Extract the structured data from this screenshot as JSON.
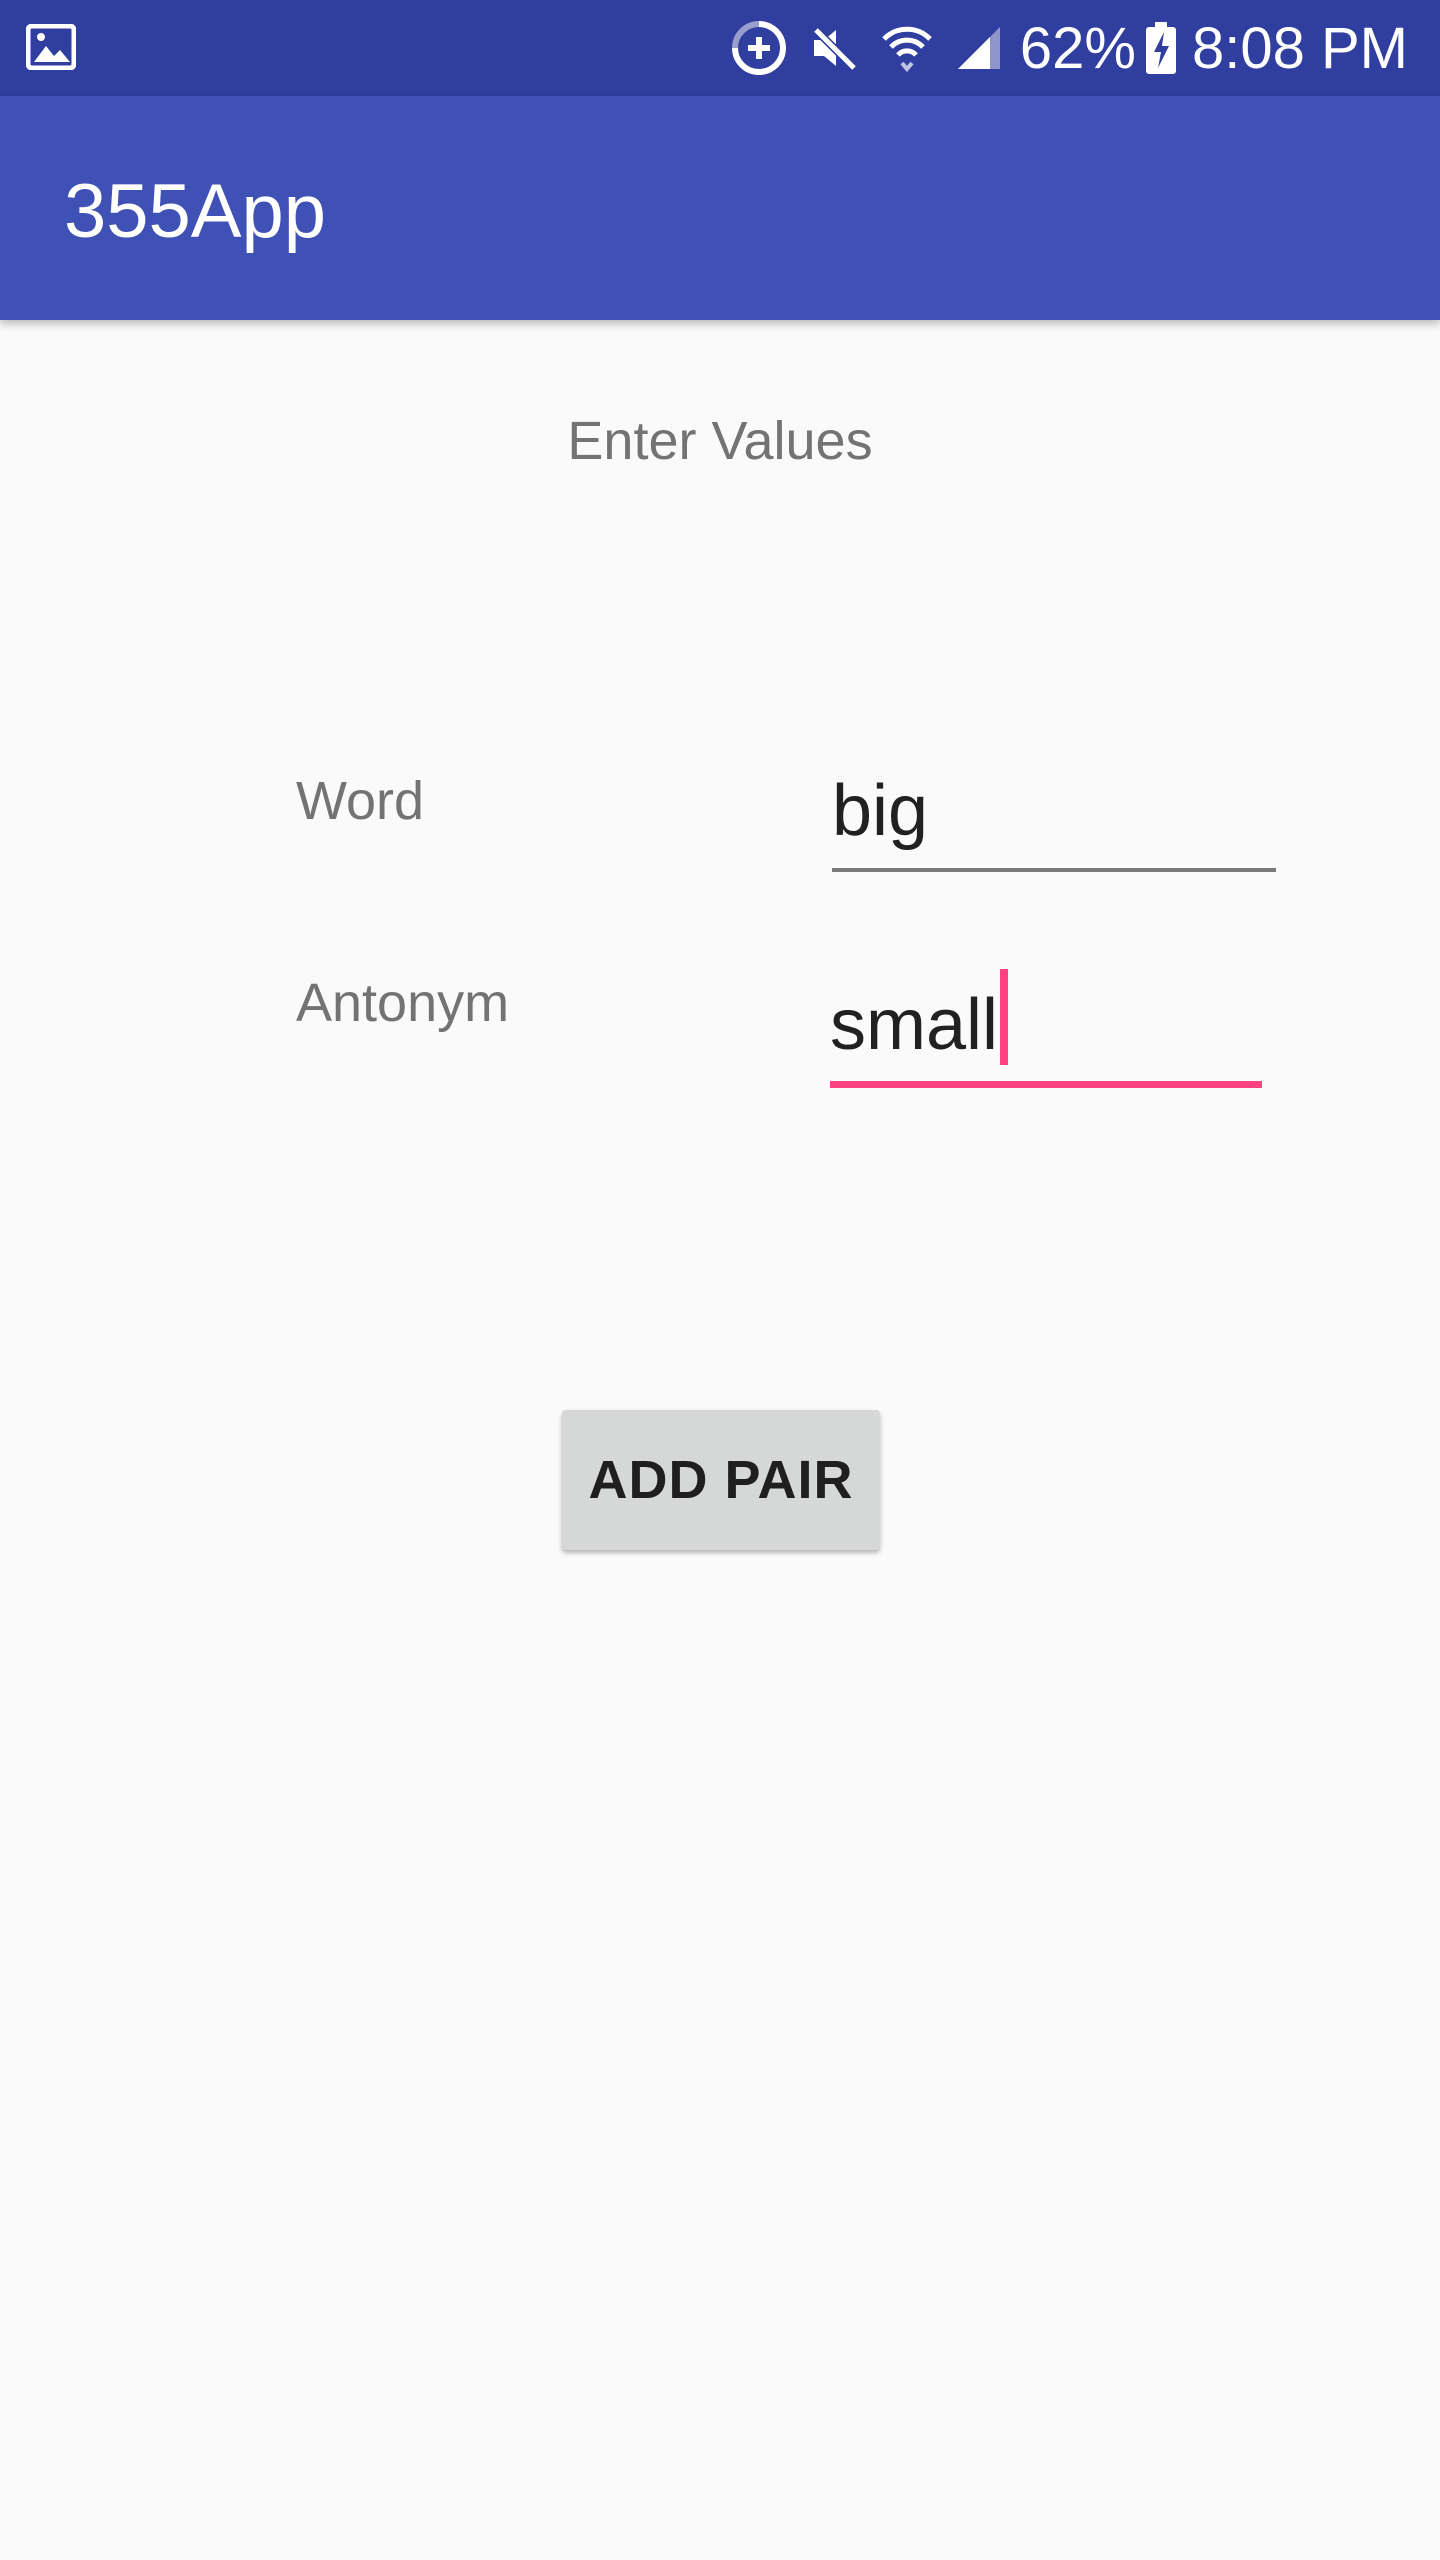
{
  "status_bar": {
    "battery": "62%",
    "time": "8:08 PM",
    "icons": [
      "gallery-icon",
      "data-saver-icon",
      "mute-icon",
      "wifi-icon",
      "signal-icon",
      "battery-charging-icon"
    ]
  },
  "app_bar": {
    "title": "355App"
  },
  "form": {
    "heading": "Enter Values",
    "word_label": "Word",
    "word_value": "big",
    "antonym_label": "Antonym",
    "antonym_value": "small",
    "add_button_label": "ADD PAIR"
  },
  "colors": {
    "status_bar": "#303f9f",
    "app_bar": "#3f51b5",
    "accent": "#ff4081",
    "background": "#fafafa"
  }
}
